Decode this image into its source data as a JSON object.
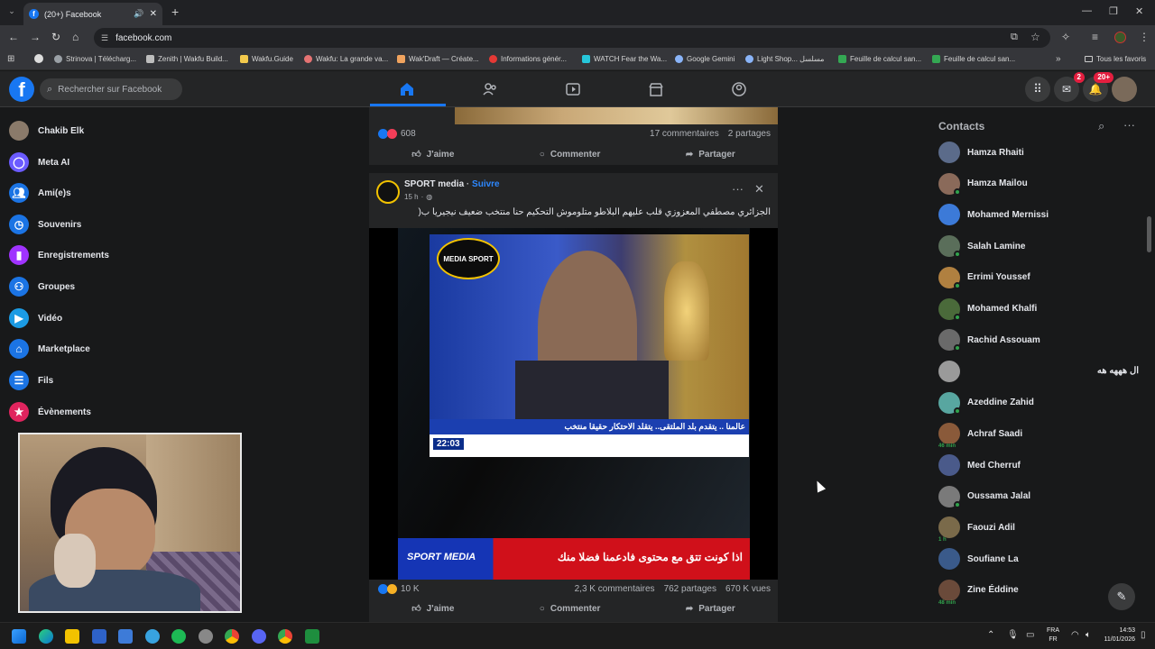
{
  "browser": {
    "tab_title": "(20+) Facebook",
    "url": "facebook.com",
    "bookmarks": [
      {
        "label": "Strinova | Télécharg...",
        "color": "#9aa0a6"
      },
      {
        "label": "Zenith | Wakfu Build...",
        "color": "#bdbdbd"
      },
      {
        "label": "Wakfu.Guide",
        "color": "#f2c94c"
      },
      {
        "label": "Wakfu: La grande va...",
        "color": "#e57373"
      },
      {
        "label": "Wak'Draft — Créate...",
        "color": "#f0a35e"
      },
      {
        "label": "Informations génér...",
        "color": "#e53935"
      },
      {
        "label": "WATCH Fear the Wa...",
        "color": "#26c6da"
      },
      {
        "label": "Google Gemini",
        "color": "#8ab4f8"
      },
      {
        "label": "Light Shop... مسلسل",
        "color": "#8ab4f8"
      },
      {
        "label": "Feuille de calcul san...",
        "color": "#34a853"
      },
      {
        "label": "Feuille de calcul san...",
        "color": "#34a853"
      }
    ],
    "all_bookmarks": "Tous les favoris"
  },
  "header": {
    "search_placeholder": "Rechercher sur Facebook",
    "messenger_badge": "2",
    "notif_badge": "20+"
  },
  "sidebar": {
    "items": [
      {
        "label": "Chakib Elk",
        "icon": "avatar",
        "color": "#8a7a6a"
      },
      {
        "label": "Meta AI",
        "icon": "meta-ai-icon",
        "color": "#6b5bff"
      },
      {
        "label": "Ami(e)s",
        "icon": "friends-icon",
        "color": "#1b74e4"
      },
      {
        "label": "Souvenirs",
        "icon": "memories-icon",
        "color": "#1b74e4"
      },
      {
        "label": "Enregistrements",
        "icon": "saved-icon",
        "color": "#a033ff"
      },
      {
        "label": "Groupes",
        "icon": "groups-icon",
        "color": "#1b74e4"
      },
      {
        "label": "Vidéo",
        "icon": "video-icon",
        "color": "#1b9be4"
      },
      {
        "label": "Marketplace",
        "icon": "marketplace-icon",
        "color": "#1b74e4"
      },
      {
        "label": "Fils",
        "icon": "feeds-icon",
        "color": "#1b74e4"
      },
      {
        "label": "Évènements",
        "icon": "events-icon",
        "color": "#e0245e"
      }
    ]
  },
  "post1": {
    "reactions": "608",
    "comments": "17 commentaires",
    "shares": "2 partages",
    "like": "J'aime",
    "comment": "Commenter",
    "share": "Partager"
  },
  "post2": {
    "page": "SPORT media",
    "follow": "Suivre",
    "time": "15 h",
    "text": "الجزائري مصطفي المعزوزي قلب عليهم البلاطو متلوموش التحكيم حنا منتخب ضعيف نيجيريا ب(",
    "video_logo": "MEDIA SPORT",
    "video_ticker": "عالمنا .. يتقدم بلد الملتقى.. يتقلد الاحتكار حقيقا منتخب",
    "video_time": "22:03",
    "banner_left": "SPORT MEDIA",
    "banner_right": "اذا كونت تتق مع محتوى فادعمنا فضلا منك",
    "reactions": "10 K",
    "comments": "2,3 K commentaires",
    "shares": "762 partages",
    "views": "670 K vues",
    "like": "J'aime",
    "comment": "Commenter",
    "share": "Partager"
  },
  "contacts": {
    "title": "Contacts",
    "list": [
      {
        "name": "Hamza Rhaiti",
        "color": "#5b6b8a",
        "online": false,
        "mins": ""
      },
      {
        "name": "Hamza Mailou",
        "color": "#8a6a5a",
        "online": true,
        "mins": ""
      },
      {
        "name": "Mohamed Mernissi",
        "color": "#3c7ad8",
        "online": false,
        "mins": ""
      },
      {
        "name": "Salah Lamine",
        "color": "#5a6e5a",
        "online": true,
        "mins": ""
      },
      {
        "name": "Errimi Youssef",
        "color": "#b08040",
        "online": true,
        "mins": ""
      },
      {
        "name": "Mohamed Khalfi",
        "color": "#4a6a3a",
        "online": true,
        "mins": ""
      },
      {
        "name": "Rachid Assouam",
        "color": "#6a6a6a",
        "online": true,
        "mins": ""
      },
      {
        "name": "ال هههه هه",
        "color": "#9a9a9a",
        "online": false,
        "mins": ""
      },
      {
        "name": "Azeddine Zahid",
        "color": "#58a6a0",
        "online": true,
        "mins": ""
      },
      {
        "name": "Achraf Saadi",
        "color": "#8a5a3a",
        "online": false,
        "mins": "46 min"
      },
      {
        "name": "Med Cherruf",
        "color": "#4a5a8a",
        "online": false,
        "mins": ""
      },
      {
        "name": "Oussama Jalal",
        "color": "#7a7a7a",
        "online": true,
        "mins": ""
      },
      {
        "name": "Faouzi Adil",
        "color": "#7a6a4a",
        "online": false,
        "mins": "1 h"
      },
      {
        "name": "Soufiane La",
        "color": "#3a5a8a",
        "online": false,
        "mins": ""
      },
      {
        "name": "Zine Éddine",
        "color": "#6a4a3a",
        "online": false,
        "mins": "48 min"
      }
    ]
  },
  "taskbar": {
    "lang": "FRA",
    "lang2": "FR",
    "time": "14:53",
    "date": "11/01/2026"
  }
}
